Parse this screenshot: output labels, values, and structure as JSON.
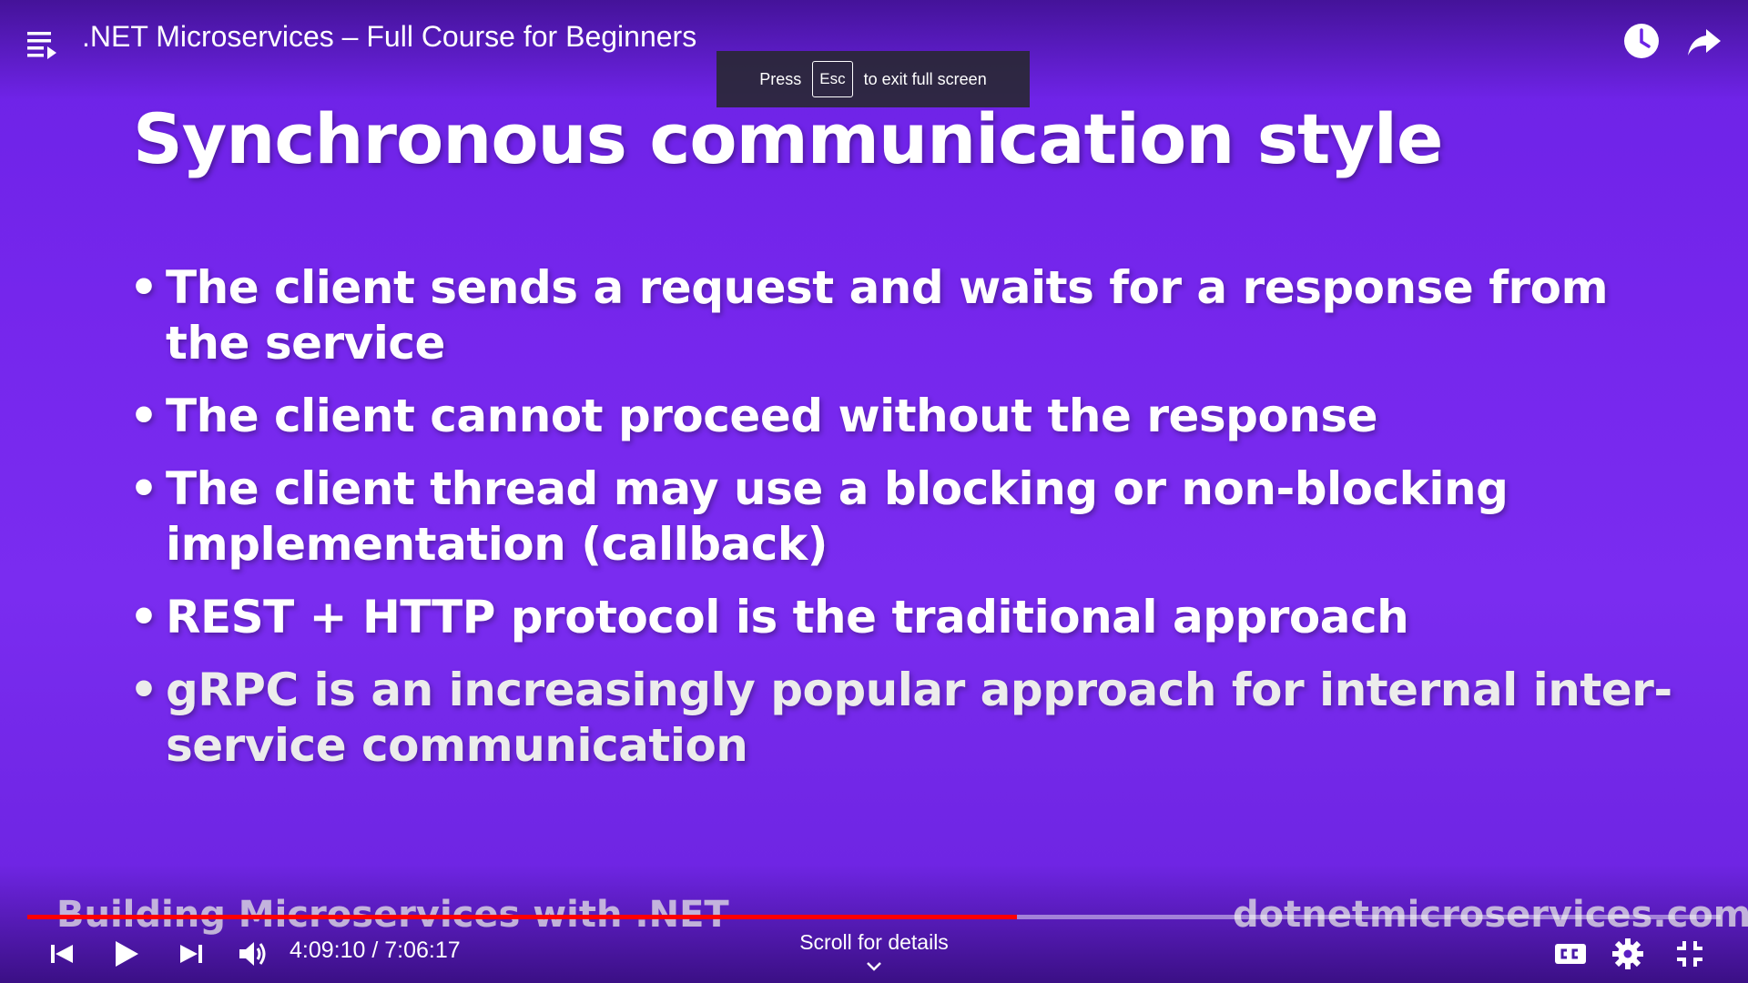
{
  "header": {
    "video_title": ".NET Microservices – Full Course for Beginners",
    "playlist_icon": "playlist-icon",
    "watch_later_icon": "clock-icon",
    "share_icon": "share-arrow-icon"
  },
  "toast": {
    "press": "Press",
    "key": "Esc",
    "message": "to exit full screen"
  },
  "slide": {
    "title": "Synchronous communication style",
    "bullets": [
      "The client sends a request and waits for a response from the service",
      "The client cannot proceed without the response",
      "The client thread may use a blocking or non-blocking implementation (callback)",
      "REST + HTTP protocol is the traditional approach",
      "gRPC is an increasingly popular approach for internal inter-service communication"
    ],
    "footer_left": "Building Microservices with .NET",
    "footer_right": "dotnetmicroservices.com"
  },
  "player": {
    "current_time": "4:09:10",
    "separator": " / ",
    "duration": "7:06:17",
    "progress_fraction": 0.5845,
    "scroll_hint": "Scroll for details",
    "colors": {
      "progress": "#ff0000",
      "background": "#7526ec"
    }
  }
}
